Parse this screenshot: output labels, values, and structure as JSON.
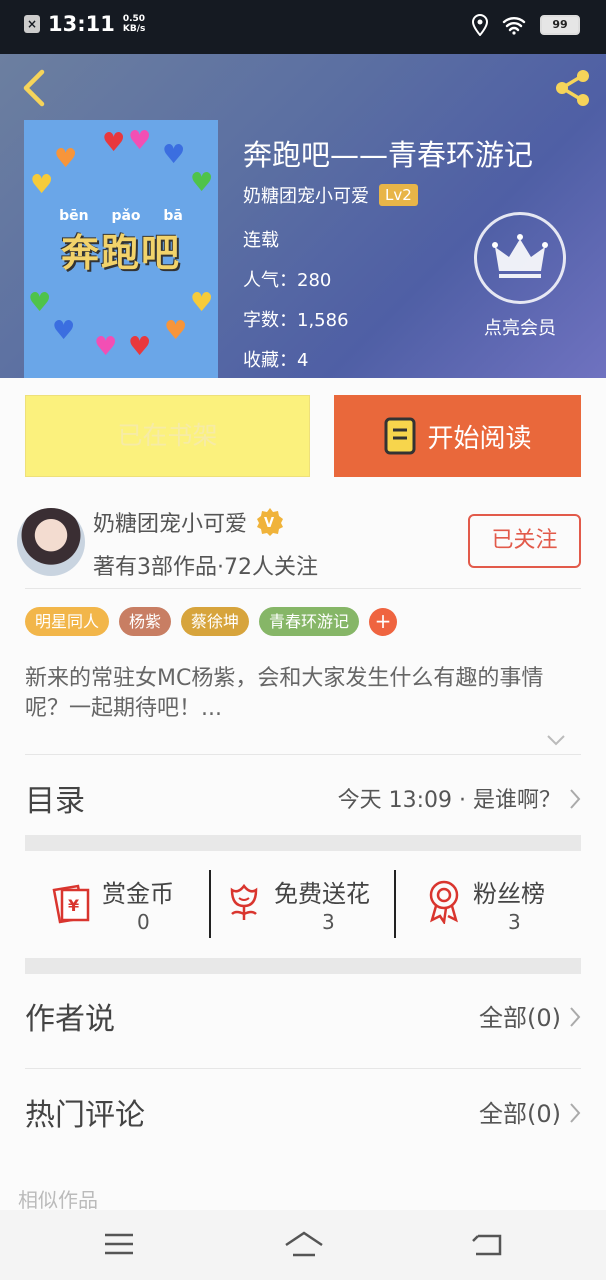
{
  "status_bar": {
    "time": "13:11",
    "net_speed_value": "0.50",
    "net_speed_unit": "KB/s",
    "battery": "99"
  },
  "book": {
    "title": "奔跑吧——青春环游记",
    "author": "奶糖团宠小可爱",
    "level": "Lv2",
    "status": "连载",
    "popularity": "人气：280",
    "word_count": "字数：1,586",
    "favorites": "收藏：4",
    "cover_text": "奔跑吧",
    "cover_pinyin": "bēn pǎo bā"
  },
  "vip_label": "点亮会员",
  "actions": {
    "shelf_label": "已在书架",
    "read_label": "开始阅读"
  },
  "author_card": {
    "name": "奶糖团宠小可爱",
    "stats": "著有3部作品·72人关注",
    "follow_label": "已关注"
  },
  "tags": [
    {
      "label": "明星同人",
      "color": "#f2b64a"
    },
    {
      "label": "杨紫",
      "color": "#c87e63"
    },
    {
      "label": "蔡徐坤",
      "color": "#d7a43c"
    },
    {
      "label": "青春环游记",
      "color": "#86b667"
    }
  ],
  "tag_add": "+",
  "description": "新来的常驻女MC杨紫，会和大家发生什么有趣的事情呢？一起期待吧！...",
  "catalog": {
    "title": "目录",
    "latest": "今天 13:09 · 是谁啊？"
  },
  "stats": [
    {
      "label": "赏金币",
      "value": "0",
      "icon": "red-envelope-icon"
    },
    {
      "label": "免费送花",
      "value": "3",
      "icon": "flower-icon"
    },
    {
      "label": "粉丝榜",
      "value": "3",
      "icon": "medal-icon"
    }
  ],
  "author_says": {
    "title": "作者说",
    "link": "全部(0)"
  },
  "hot_comments": {
    "title": "热门评论",
    "link": "全部(0)"
  },
  "similar_title": "相似作品",
  "colors": {
    "accent": "#e9683b",
    "follow": "#e25a4a",
    "shelf": "#fbf17d"
  }
}
